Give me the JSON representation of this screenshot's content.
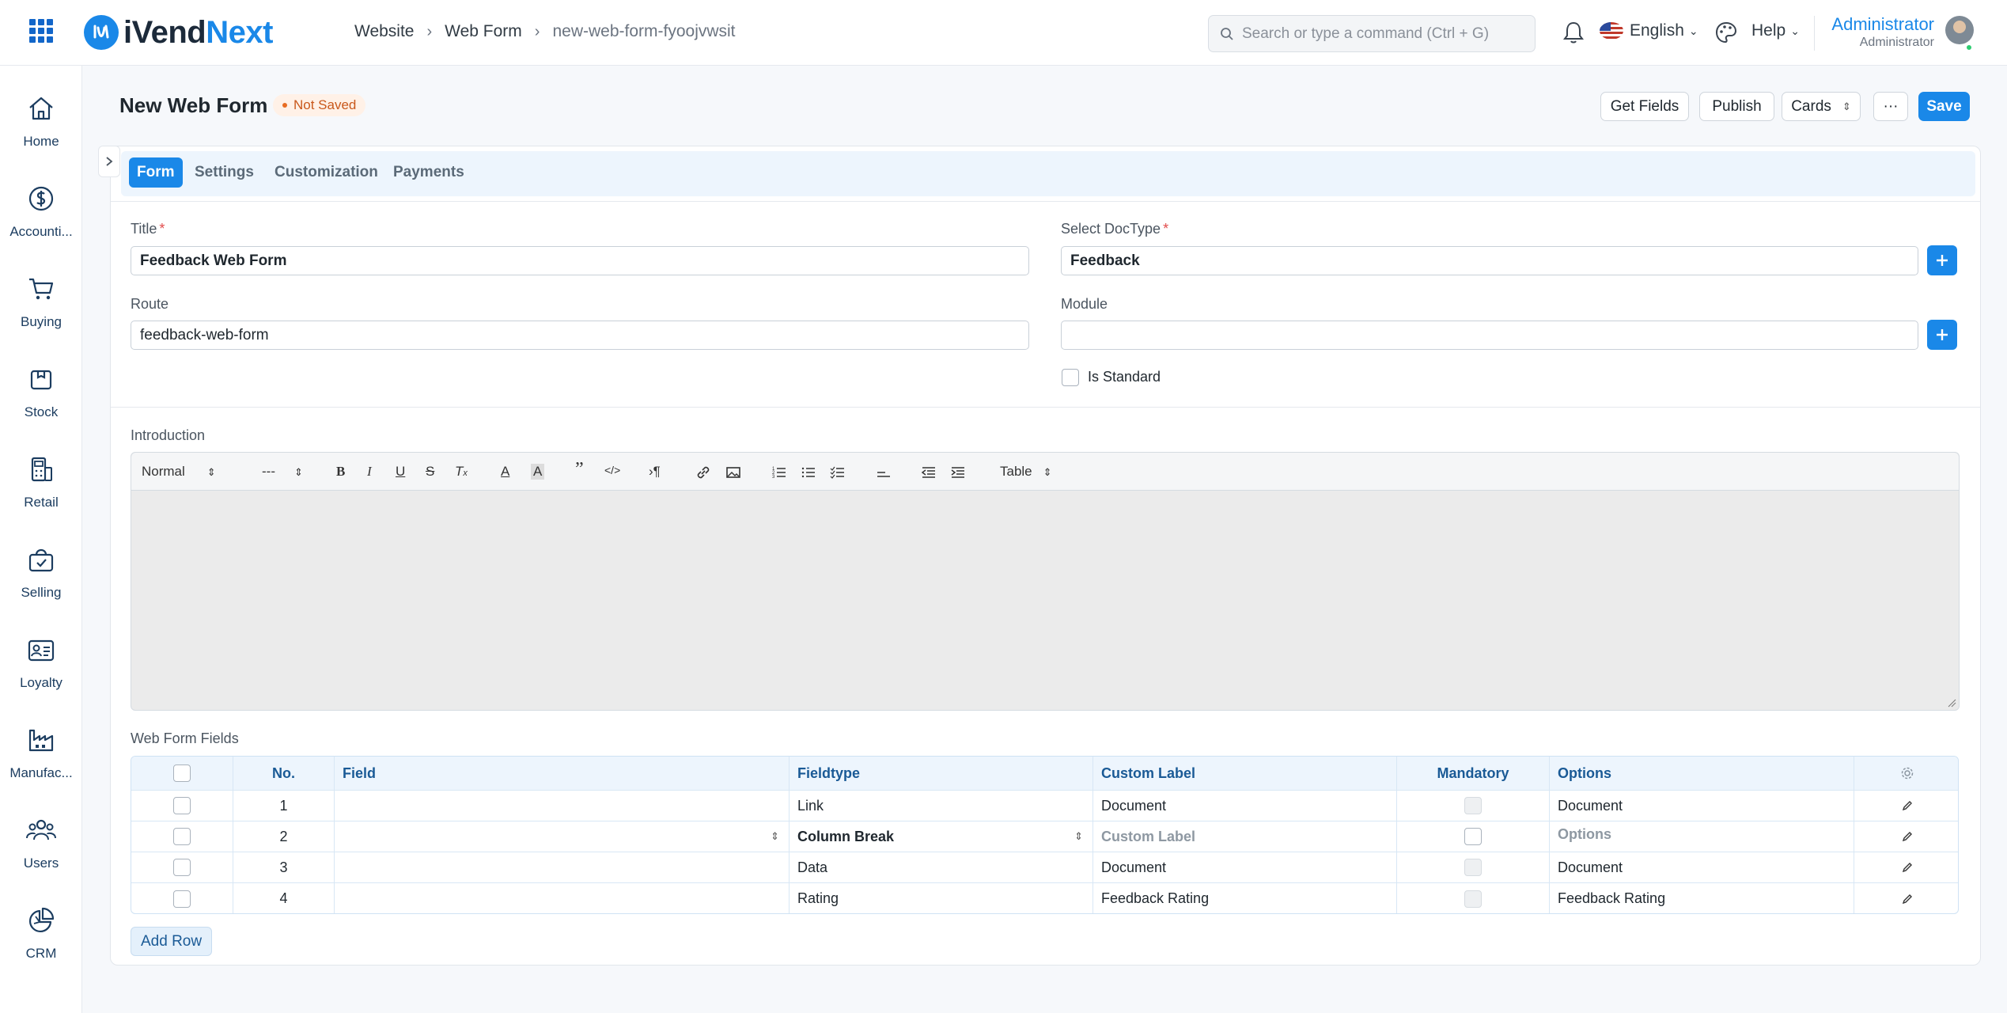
{
  "app": {
    "brand_prefix": "iVend",
    "brand_suffix": "Next",
    "brand_color": "#1a88e8"
  },
  "breadcrumb": [
    "Website",
    "Web Form",
    "new-web-form-fyoojvwsit"
  ],
  "search": {
    "placeholder": "Search or type a command (Ctrl + G)"
  },
  "topbar": {
    "language": "English",
    "help": "Help",
    "user_name": "Administrator",
    "user_role": "Administrator"
  },
  "sidebar": {
    "items": [
      {
        "label": "Home",
        "icon": "home-icon"
      },
      {
        "label": "Accounti...",
        "icon": "dollar-icon"
      },
      {
        "label": "Buying",
        "icon": "cart-icon"
      },
      {
        "label": "Stock",
        "icon": "box-icon"
      },
      {
        "label": "Retail",
        "icon": "pos-icon"
      },
      {
        "label": "Selling",
        "icon": "bag-icon"
      },
      {
        "label": "Loyalty",
        "icon": "id-card-icon"
      },
      {
        "label": "Manufac...",
        "icon": "factory-icon"
      },
      {
        "label": "Users",
        "icon": "users-icon"
      },
      {
        "label": "CRM",
        "icon": "pie-chart-icon"
      }
    ]
  },
  "page": {
    "title": "New Web Form",
    "status": "Not Saved",
    "actions": {
      "get_fields": "Get Fields",
      "publish": "Publish",
      "cards": "Cards",
      "more": "···",
      "save": "Save"
    }
  },
  "tabs": [
    "Form",
    "Settings",
    "Customization",
    "Payments"
  ],
  "form": {
    "title_label": "Title",
    "title_value": "Feedback Web Form",
    "doctype_label": "Select DocType",
    "doctype_value": "Feedback",
    "route_label": "Route",
    "route_value": "feedback-web-form",
    "module_label": "Module",
    "module_value": "",
    "is_standard_label": "Is Standard",
    "introduction_label": "Introduction"
  },
  "editor_toolbar": {
    "style": "Normal",
    "font": "---",
    "table": "Table"
  },
  "web_form_fields": {
    "label": "Web Form Fields",
    "columns": [
      "No.",
      "Field",
      "Fieldtype",
      "Custom Label",
      "Mandatory",
      "Options"
    ],
    "rows": [
      {
        "no": "1",
        "field": "",
        "fieldtype": "Link",
        "label": "Document",
        "options": "Document"
      },
      {
        "no": "2",
        "field": "",
        "fieldtype": "Column Break",
        "label": "",
        "options": ""
      },
      {
        "no": "3",
        "field": "",
        "fieldtype": "Data",
        "label": "Document",
        "options": "Document"
      },
      {
        "no": "4",
        "field": "",
        "fieldtype": "Rating",
        "label": "Feedback Rating",
        "options": "Feedback Rating"
      }
    ],
    "label_placeholder": "Custom Label",
    "options_placeholder": "Options",
    "add_row": "Add Row"
  }
}
